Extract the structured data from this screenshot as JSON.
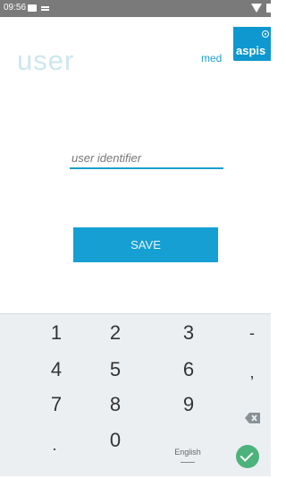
{
  "status_bar": {
    "time": "09:56"
  },
  "header": {
    "title": "user",
    "logo_prefix": "med",
    "logo_box_text": "aspis"
  },
  "form": {
    "user_identifier_placeholder": "user identifier",
    "save_label": "SAVE"
  },
  "keyboard": {
    "row1": [
      "1",
      "2",
      "3",
      "-"
    ],
    "row2": [
      "4",
      "5",
      "6",
      ","
    ],
    "row3": [
      "7",
      "8",
      "9"
    ],
    "row4": [
      ".",
      "0"
    ],
    "language": "English",
    "backspace_icon": "backspace-icon",
    "done_icon": "check-icon"
  },
  "colors": {
    "accent": "#159fd2",
    "keyboard_bg": "#eceff1",
    "done": "#4db37c",
    "title": "#cce7ee"
  }
}
